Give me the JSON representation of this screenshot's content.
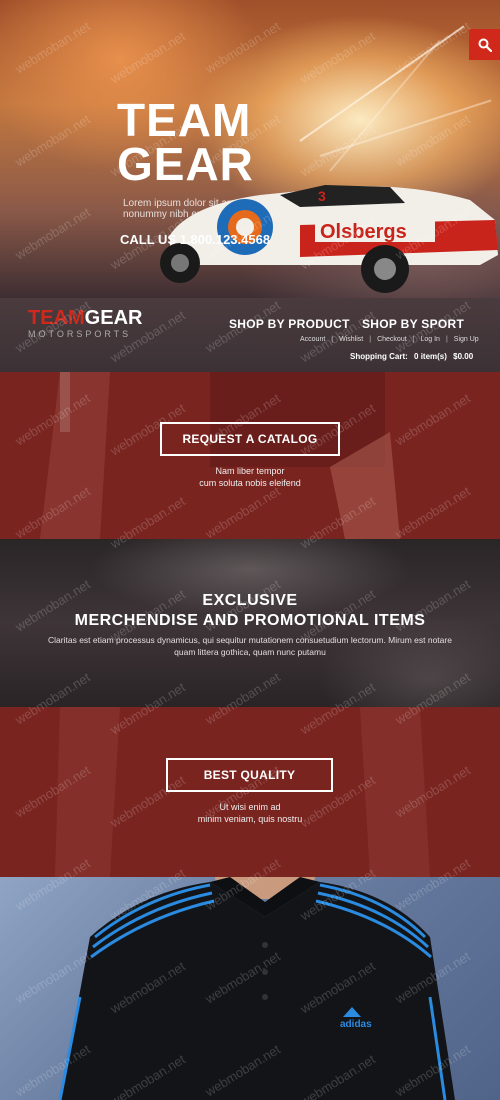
{
  "hero": {
    "title_line1": "TEAM",
    "title_line2": "GEAR",
    "subtitle": "Lorem ipsum dolor sit amet, consectetuer adipiscing elit, sed diam nonummy nibh euismod tincidunt.",
    "call": "CALL US 1.800.123.4568",
    "car_number": "3",
    "car_brand": "Olsbergs"
  },
  "search": {
    "icon": "search-icon"
  },
  "logo": {
    "team": "TEAM",
    "gear": "GEAR",
    "tagline": "MOTORSPORTS"
  },
  "nav": {
    "shop_by_product": "SHOP BY PRODUCT",
    "shop_by_sport": "SHOP BY SPORT",
    "links": [
      "Account",
      "Wishlist",
      "Checkout",
      "Log In",
      "Sign Up"
    ],
    "cart_label": "Shopping Cart:",
    "cart_items": "0 item(s)",
    "cart_total": "$0.00"
  },
  "catalog": {
    "button": "REQUEST A CATALOG",
    "line1": "Nam liber tempor",
    "line2": "cum soluta nobis eleifend"
  },
  "exclusive": {
    "title_line1": "EXCLUSIVE",
    "title_line2": "MERCHENDISE AND PROMOTIONAL ITEMS",
    "body": "Claritas est etiam processus dynamicus, qui sequitur mutationem consuetudium lectorum. Mirum est notare quam littera gothica, quam nunc putamu"
  },
  "quality": {
    "button": "BEST QUALITY",
    "line1": "Ut wisi enim ad",
    "line2": "minim veniam, quis nostru"
  },
  "shirt": {
    "brand": "adidas"
  },
  "watermark": "webmoban.net",
  "colors": {
    "accent": "#d0291c",
    "panel_red": "#7a2420",
    "nav_bg": "#3c3236"
  }
}
